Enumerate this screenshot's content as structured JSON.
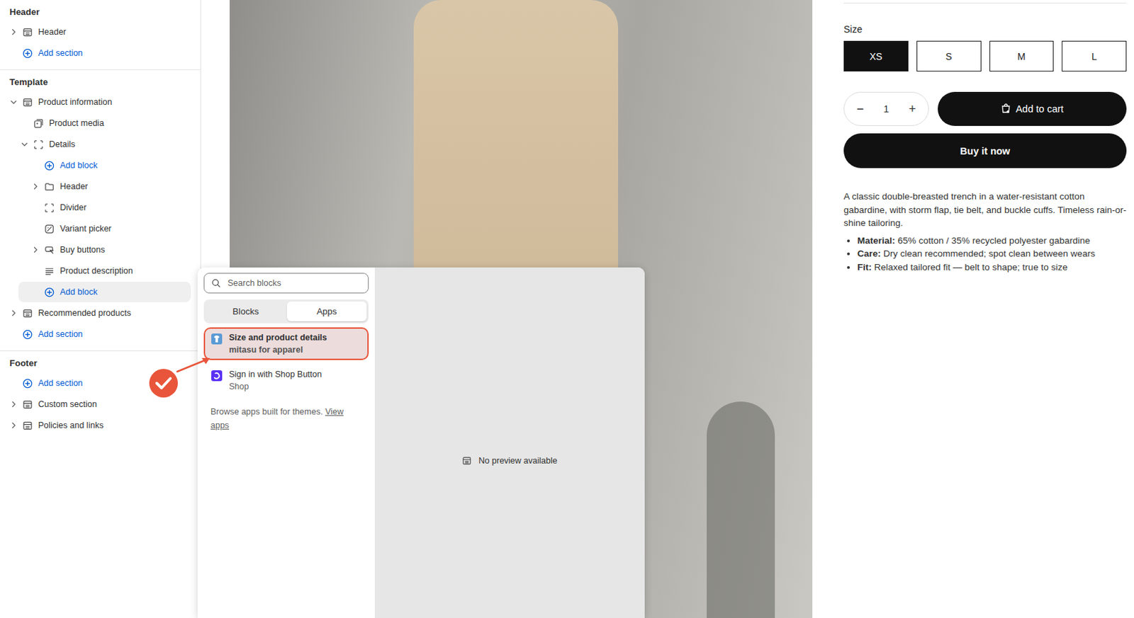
{
  "sidebar": {
    "groups": [
      {
        "title": "Header",
        "items": [
          {
            "kind": "section",
            "label": "Header",
            "level": 0,
            "expandable": true,
            "expanded": false,
            "selected": false
          },
          {
            "kind": "add",
            "label": "Add section",
            "level": 0,
            "expandable": false,
            "expanded": false,
            "selected": false
          }
        ]
      },
      {
        "title": "Template",
        "items": [
          {
            "kind": "section",
            "label": "Product information",
            "level": 0,
            "expandable": true,
            "expanded": true,
            "selected": false
          },
          {
            "kind": "media",
            "label": "Product media",
            "level": 1,
            "expandable": false,
            "expanded": false,
            "selected": false
          },
          {
            "kind": "group",
            "label": "Details",
            "level": 1,
            "expandable": true,
            "expanded": true,
            "selected": false
          },
          {
            "kind": "add",
            "label": "Add block",
            "level": 2,
            "expandable": false,
            "expanded": false,
            "selected": false
          },
          {
            "kind": "folder",
            "label": "Header",
            "level": 2,
            "expandable": true,
            "expanded": false,
            "selected": false
          },
          {
            "kind": "group",
            "label": "Divider",
            "level": 2,
            "expandable": false,
            "expanded": false,
            "selected": false
          },
          {
            "kind": "variant",
            "label": "Variant picker",
            "level": 2,
            "expandable": false,
            "expanded": false,
            "selected": false
          },
          {
            "kind": "buttons",
            "label": "Buy buttons",
            "level": 2,
            "expandable": true,
            "expanded": false,
            "selected": false
          },
          {
            "kind": "text",
            "label": "Product description",
            "level": 2,
            "expandable": false,
            "expanded": false,
            "selected": false
          },
          {
            "kind": "add",
            "label": "Add block",
            "level": 1,
            "expandable": false,
            "expanded": false,
            "selected": true
          },
          {
            "kind": "section",
            "label": "Recommended products",
            "level": 0,
            "expandable": true,
            "expanded": false,
            "selected": false
          },
          {
            "kind": "add",
            "label": "Add section",
            "level": 0,
            "expandable": false,
            "expanded": false,
            "selected": false
          }
        ]
      },
      {
        "title": "Footer",
        "items": [
          {
            "kind": "add",
            "label": "Add section",
            "level": 0,
            "expandable": false,
            "expanded": false,
            "selected": false
          },
          {
            "kind": "section",
            "label": "Custom section",
            "level": 0,
            "expandable": true,
            "expanded": false,
            "selected": false
          },
          {
            "kind": "section",
            "label": "Policies and links",
            "level": 0,
            "expandable": true,
            "expanded": false,
            "selected": false
          }
        ]
      }
    ]
  },
  "product": {
    "size_label": "Size",
    "sizes": [
      {
        "label": "XS",
        "selected": true
      },
      {
        "label": "S",
        "selected": false
      },
      {
        "label": "M",
        "selected": false
      },
      {
        "label": "L",
        "selected": false
      }
    ],
    "quantity": {
      "minus": "−",
      "value": "1",
      "plus": "+"
    },
    "add_to_cart": "Add to cart",
    "buy_now": "Buy it now",
    "description": "A classic double-breasted trench in a water-resistant cotton gabardine, with storm flap, tie belt, and buckle cuffs. Timeless rain-or-shine tailoring.",
    "bullets": [
      {
        "label": "Material:",
        "text": "65% cotton / 35% recycled polyester gabardine"
      },
      {
        "label": "Care:",
        "text": "Dry clean recommended; spot clean between wears"
      },
      {
        "label": "Fit:",
        "text": "Relaxed tailored fit — belt to shape; true to size"
      }
    ]
  },
  "picker": {
    "search": {
      "placeholder": "Search blocks"
    },
    "tabs": [
      {
        "label": "Blocks",
        "selected": false
      },
      {
        "label": "Apps",
        "selected": true
      }
    ],
    "apps": [
      {
        "name": "Size and product details",
        "vendor": "mitasu for apparel",
        "highlighted": true
      },
      {
        "name": "Sign in with Shop Button",
        "vendor": "Shop",
        "highlighted": false
      }
    ],
    "browse_text": "Browse apps built for themes.",
    "browse_link": "View apps",
    "preview": "No preview available"
  }
}
